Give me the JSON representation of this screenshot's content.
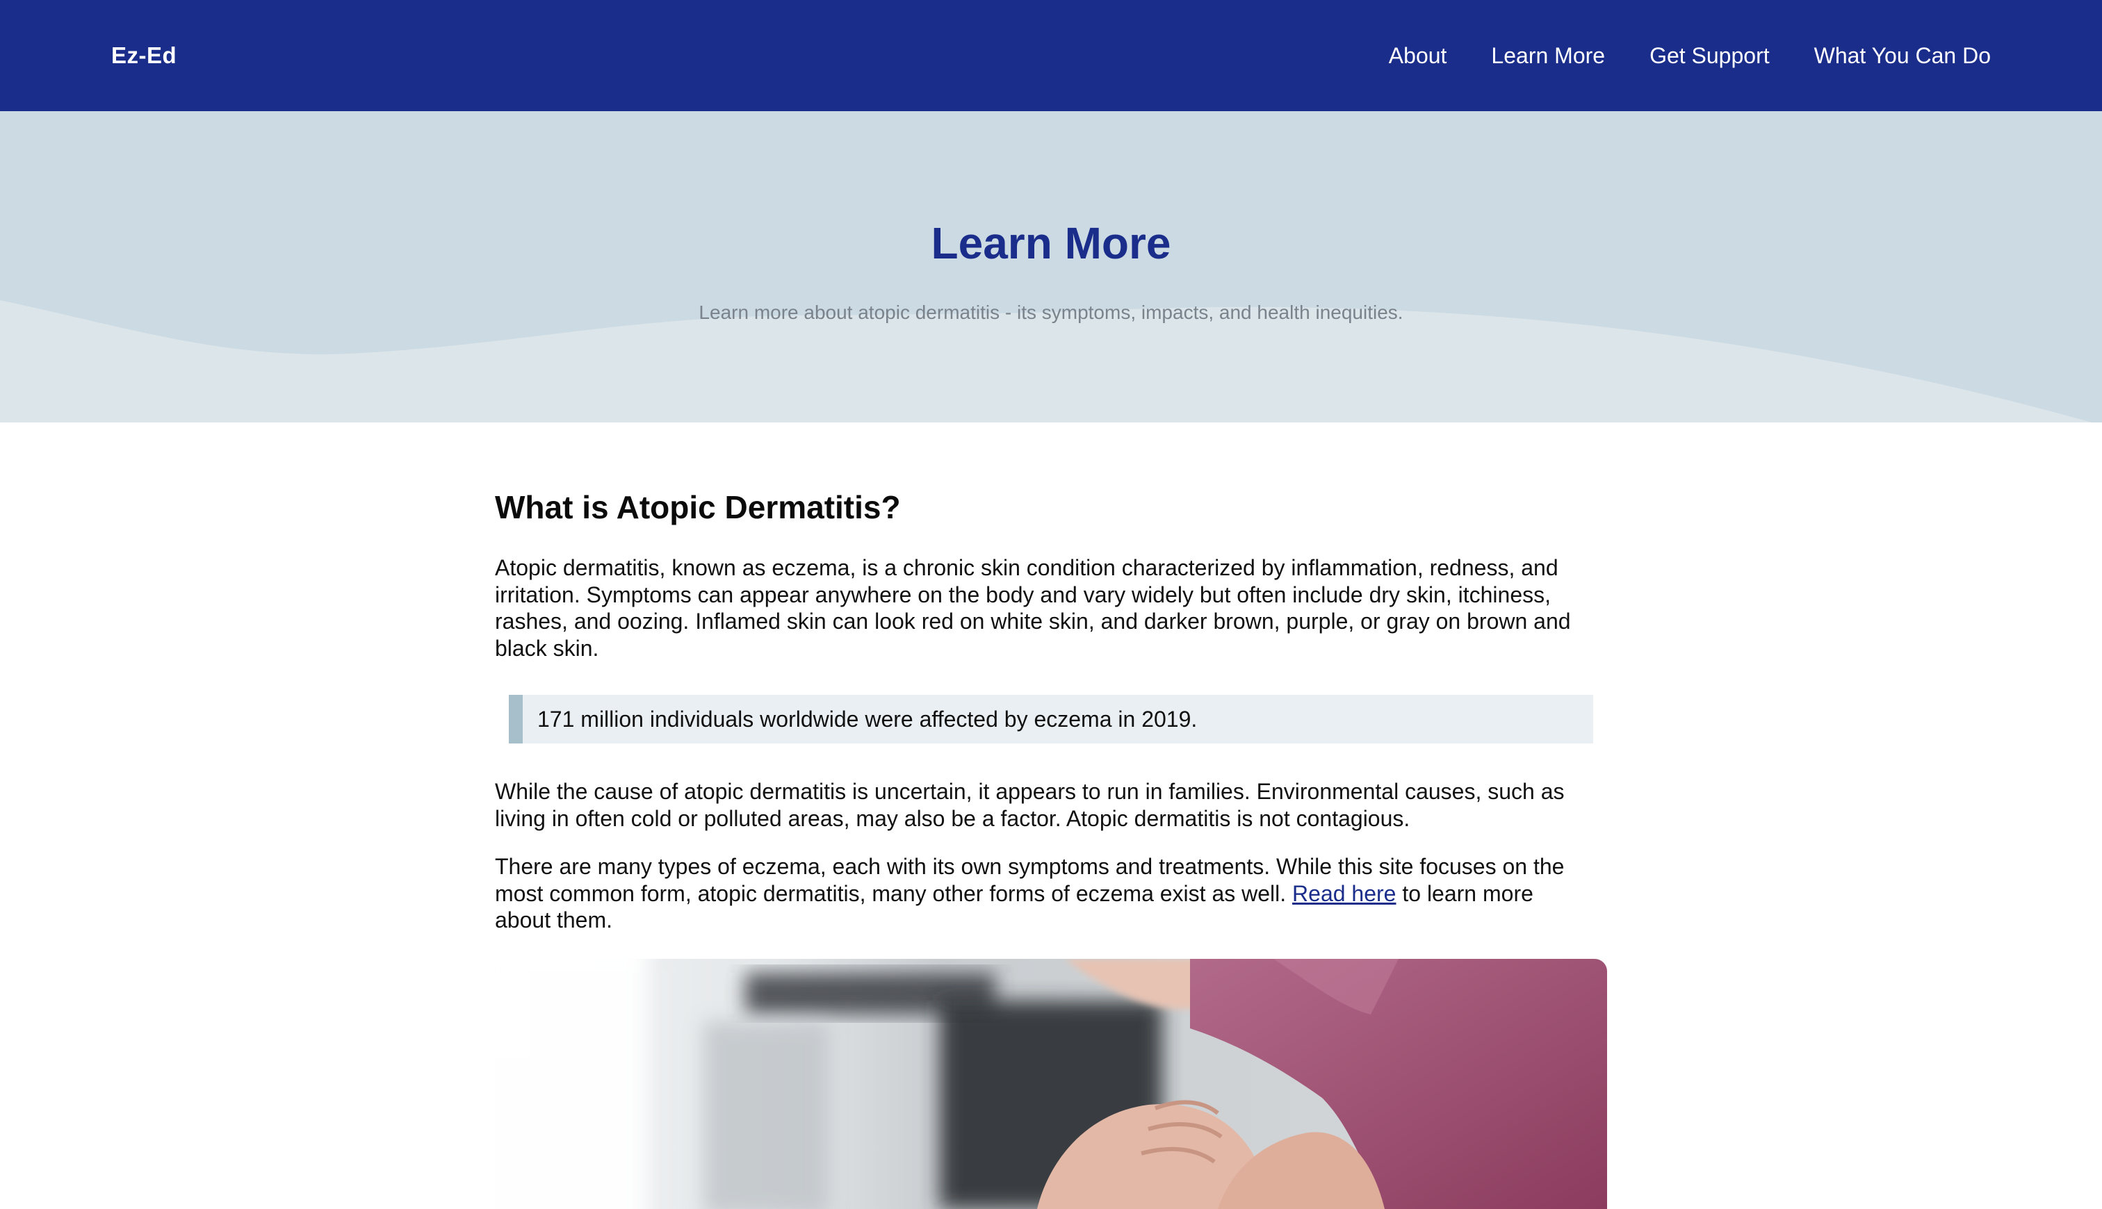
{
  "navbar": {
    "brand": "Ez-Ed",
    "links": [
      "About",
      "Learn More",
      "Get Support",
      "What You Can Do"
    ]
  },
  "hero": {
    "title": "Learn More",
    "subtitle": "Learn more about atopic dermatitis - its symptoms, impacts, and health inequities."
  },
  "main": {
    "heading": "What is Atopic Dermatitis?",
    "paragraph1": "Atopic dermatitis, known as eczema, is a chronic skin condition characterized by inflammation, redness, and irritation. Symptoms can appear anywhere on the body and vary widely but often include dry skin, itchiness, rashes, and oozing. Inflamed skin can look red on white skin, and darker brown, purple, or gray on brown and black skin.",
    "callout": "171 million individuals worldwide were affected by eczema in 2019.",
    "paragraph2": "While the cause of atopic dermatitis is uncertain, it appears to run in families. Environmental causes, such as living in often cold or polluted areas, may also be a factor. Atopic dermatitis is not contagious.",
    "paragraph3_before": "There are many types of eczema, each with its own symptoms and treatments. While this site focuses on the most common form, atopic dermatitis, many other forms of eczema exist as well. ",
    "paragraph3_link": "Read here",
    "paragraph3_after": " to learn more about them."
  },
  "colors": {
    "navbar_bg": "#1a2d8b",
    "hero_bg": "#ccdae3",
    "hero_wave": "#dbe5ea",
    "title_color": "#1a2d8b",
    "callout_bg": "#e9eff2",
    "callout_border": "#a7bfcb"
  }
}
